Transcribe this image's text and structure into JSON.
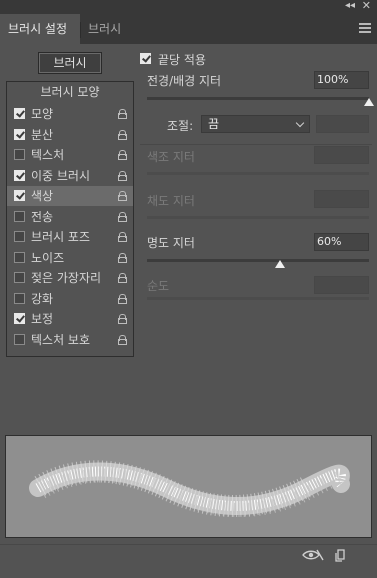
{
  "window": {
    "collapse_glyph": "◂◂",
    "close_glyph": "✕"
  },
  "tabs": [
    {
      "label": "브러시 설정",
      "active": true
    },
    {
      "label": "브러시",
      "active": false
    }
  ],
  "panel_menu_icon": "hamburger-menu-icon",
  "brush_button": {
    "label": "브러시"
  },
  "brush_list": {
    "header": "브러시 모양",
    "items": [
      {
        "label": "모양",
        "checked": true,
        "selected": false
      },
      {
        "label": "분산",
        "checked": true,
        "selected": false
      },
      {
        "label": "텍스처",
        "checked": false,
        "selected": false
      },
      {
        "label": "이중 브러시",
        "checked": true,
        "selected": false
      },
      {
        "label": "색상",
        "checked": true,
        "selected": true
      },
      {
        "label": "전송",
        "checked": false,
        "selected": false
      },
      {
        "label": "브러시 포즈",
        "checked": false,
        "selected": false
      },
      {
        "label": "노이즈",
        "checked": false,
        "selected": false
      },
      {
        "label": "젖은 가장자리",
        "checked": false,
        "selected": false
      },
      {
        "label": "강화",
        "checked": false,
        "selected": false
      },
      {
        "label": "보정",
        "checked": true,
        "selected": false
      },
      {
        "label": "텍스처 보호",
        "checked": false,
        "selected": false
      }
    ]
  },
  "color_dynamics": {
    "apply_per_tip": {
      "label": "끝당 적용",
      "checked": true
    },
    "fg_bg_jitter": {
      "label": "전경/배경 지터",
      "value": "100%",
      "level_pct": 100
    },
    "control": {
      "label": "조절:",
      "value": "끔"
    },
    "hue_jitter": {
      "label": "색조 지터",
      "enabled": false
    },
    "saturation_jitter": {
      "label": "채도 지터",
      "enabled": false
    },
    "brightness_jitter": {
      "label": "명도 지터",
      "value": "60%",
      "level_pct": 60
    },
    "purity": {
      "label": "순도",
      "enabled": false
    }
  },
  "footer": {
    "toggle_icon": "eye-toggle-icon",
    "new_preset_icon": "new-preset-icon"
  },
  "colors": {
    "panel_bg": "#535353",
    "tabbar_bg": "#383838",
    "selected_row": "#6b6b6b",
    "preview_bg": "#8f8f8f"
  }
}
